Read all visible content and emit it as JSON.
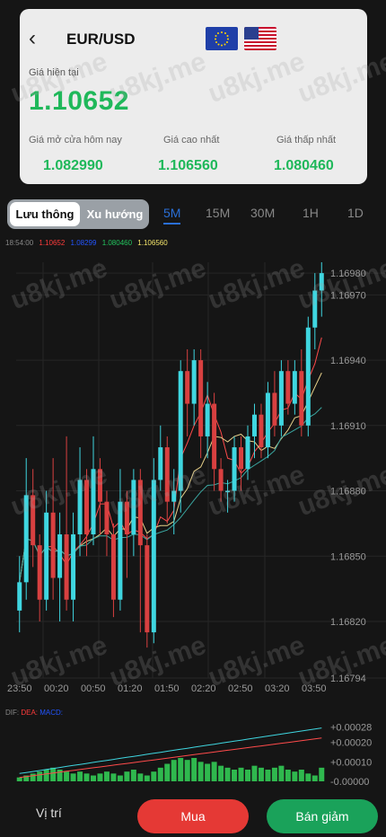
{
  "header": {
    "pair": "EUR/USD",
    "current_label": "Giá hiện tại",
    "current_price": "1.10652",
    "stats": [
      {
        "label": "Giá mở cửa hôm nay",
        "value": "1.082990"
      },
      {
        "label": "Giá cao nhất",
        "value": "1.106560"
      },
      {
        "label": "Giá thấp nhất",
        "value": "1.080460"
      }
    ]
  },
  "tabs": {
    "active": "Lưu thông",
    "inactive": "Xu hướng"
  },
  "timeframes": [
    "5M",
    "15M",
    "30M",
    "1H",
    "1D"
  ],
  "active_timeframe": "5M",
  "chart_legend": {
    "time": "18:54:00",
    "values": [
      "1.10652",
      "1.08299",
      "1.080460",
      "1.106560"
    ],
    "colors": [
      "#ff3b3b",
      "#2255ff",
      "#22c55e",
      "#f5e66b"
    ]
  },
  "watermark": "u8kj.me",
  "chart_data": [
    {
      "type": "candlestick",
      "y_ticks": [
        "1.16980",
        "1.16970",
        "1.16940",
        "1.16910",
        "1.16880",
        "1.16850",
        "1.16820",
        "1.16794"
      ],
      "x_ticks": [
        "23:50",
        "00:20",
        "00:50",
        "01:20",
        "01:50",
        "02:20",
        "02:50",
        "03:20",
        "03:50"
      ],
      "candles": [
        {
          "o": 1.16825,
          "c": 1.16838,
          "h": 1.1685,
          "l": 1.16815
        },
        {
          "o": 1.16838,
          "c": 1.16878,
          "h": 1.16895,
          "l": 1.1683
        },
        {
          "o": 1.16878,
          "c": 1.16855,
          "h": 1.1689,
          "l": 1.16845
        },
        {
          "o": 1.16855,
          "c": 1.1683,
          "h": 1.1686,
          "l": 1.1682
        },
        {
          "o": 1.1683,
          "c": 1.1687,
          "h": 1.1688,
          "l": 1.16825
        },
        {
          "o": 1.1687,
          "c": 1.1684,
          "h": 1.16895,
          "l": 1.1683
        },
        {
          "o": 1.1684,
          "c": 1.1686,
          "h": 1.1687,
          "l": 1.1682
        },
        {
          "o": 1.1686,
          "c": 1.1683,
          "h": 1.16905,
          "l": 1.16825
        },
        {
          "o": 1.1683,
          "c": 1.1686,
          "h": 1.1687,
          "l": 1.1682
        },
        {
          "o": 1.1686,
          "c": 1.16885,
          "h": 1.169,
          "l": 1.1685
        },
        {
          "o": 1.16885,
          "c": 1.1686,
          "h": 1.1689,
          "l": 1.1685
        },
        {
          "o": 1.1686,
          "c": 1.1689,
          "h": 1.16905,
          "l": 1.16855
        },
        {
          "o": 1.1689,
          "c": 1.16875,
          "h": 1.16895,
          "l": 1.1686
        },
        {
          "o": 1.16875,
          "c": 1.1686,
          "h": 1.1688,
          "l": 1.1685
        },
        {
          "o": 1.1686,
          "c": 1.1683,
          "h": 1.16865,
          "l": 1.16822
        },
        {
          "o": 1.1683,
          "c": 1.16875,
          "h": 1.1689,
          "l": 1.16825
        },
        {
          "o": 1.16875,
          "c": 1.1686,
          "h": 1.1688,
          "l": 1.1684
        },
        {
          "o": 1.1686,
          "c": 1.16885,
          "h": 1.1689,
          "l": 1.1685
        },
        {
          "o": 1.16885,
          "c": 1.16855,
          "h": 1.1689,
          "l": 1.16815
        },
        {
          "o": 1.16855,
          "c": 1.16815,
          "h": 1.1686,
          "l": 1.16808
        },
        {
          "o": 1.16815,
          "c": 1.16885,
          "h": 1.16895,
          "l": 1.1681
        },
        {
          "o": 1.16885,
          "c": 1.169,
          "h": 1.1691,
          "l": 1.1688
        },
        {
          "o": 1.169,
          "c": 1.16875,
          "h": 1.16905,
          "l": 1.16865
        },
        {
          "o": 1.16875,
          "c": 1.1688,
          "h": 1.1689,
          "l": 1.1686
        },
        {
          "o": 1.1688,
          "c": 1.16935,
          "h": 1.1694,
          "l": 1.1687
        },
        {
          "o": 1.16935,
          "c": 1.1692,
          "h": 1.16945,
          "l": 1.16905
        },
        {
          "o": 1.1692,
          "c": 1.1694,
          "h": 1.16945,
          "l": 1.1691
        },
        {
          "o": 1.1694,
          "c": 1.16905,
          "h": 1.16945,
          "l": 1.16895
        },
        {
          "o": 1.16905,
          "c": 1.1692,
          "h": 1.1693,
          "l": 1.16895
        },
        {
          "o": 1.1692,
          "c": 1.1689,
          "h": 1.16925,
          "l": 1.1688
        },
        {
          "o": 1.1689,
          "c": 1.1688,
          "h": 1.16895,
          "l": 1.16875
        },
        {
          "o": 1.1688,
          "c": 1.1688,
          "h": 1.16885,
          "l": 1.1687
        },
        {
          "o": 1.1688,
          "c": 1.169,
          "h": 1.16905,
          "l": 1.16875
        },
        {
          "o": 1.169,
          "c": 1.1689,
          "h": 1.16905,
          "l": 1.1688
        },
        {
          "o": 1.1689,
          "c": 1.16905,
          "h": 1.1691,
          "l": 1.16885
        },
        {
          "o": 1.16905,
          "c": 1.16915,
          "h": 1.1692,
          "l": 1.16895
        },
        {
          "o": 1.16915,
          "c": 1.169,
          "h": 1.1692,
          "l": 1.16895
        },
        {
          "o": 1.169,
          "c": 1.16925,
          "h": 1.1693,
          "l": 1.16895
        },
        {
          "o": 1.16925,
          "c": 1.1691,
          "h": 1.16935,
          "l": 1.16905
        },
        {
          "o": 1.1691,
          "c": 1.16935,
          "h": 1.1694,
          "l": 1.16905
        },
        {
          "o": 1.16935,
          "c": 1.1692,
          "h": 1.1694,
          "l": 1.16915
        },
        {
          "o": 1.1692,
          "c": 1.16935,
          "h": 1.1694,
          "l": 1.16915
        },
        {
          "o": 1.16935,
          "c": 1.1691,
          "h": 1.16945,
          "l": 1.16905
        },
        {
          "o": 1.1691,
          "c": 1.16955,
          "h": 1.1696,
          "l": 1.16905
        },
        {
          "o": 1.16955,
          "c": 1.16972,
          "h": 1.1698,
          "l": 1.16945
        },
        {
          "o": 1.16972,
          "c": 1.1698,
          "h": 1.16985,
          "l": 1.1696
        }
      ],
      "up_color": "#3fd6e0",
      "down_color": "#d84040"
    },
    {
      "type": "bar",
      "indicator": "MACD",
      "labels": [
        "DIF:",
        "DEA:",
        "MACD:"
      ],
      "label_colors": [
        "#888888",
        "#ff3b3b",
        "#2255ff"
      ],
      "y_ticks": [
        "+0.00028",
        "+0.00020",
        "+0.00010",
        "-0.00000"
      ],
      "values": [
        2e-05,
        3e-05,
        4e-05,
        5e-05,
        6e-05,
        7e-05,
        6e-05,
        5e-05,
        4e-05,
        5e-05,
        4e-05,
        3e-05,
        4e-05,
        5e-05,
        4e-05,
        3e-05,
        5e-05,
        6e-05,
        4e-05,
        3e-05,
        5e-05,
        7e-05,
        9e-05,
        0.00011,
        0.00012,
        0.00011,
        0.00012,
        0.0001,
        9e-05,
        0.0001,
        8e-05,
        7e-05,
        6e-05,
        7e-05,
        6e-05,
        8e-05,
        7e-05,
        6e-05,
        7e-05,
        8e-05,
        6e-05,
        5e-05,
        6e-05,
        4e-05,
        3e-05,
        7e-05
      ]
    }
  ],
  "actions": {
    "position": "Vị trí",
    "buy": "Mua",
    "sell": "Bán giảm"
  }
}
